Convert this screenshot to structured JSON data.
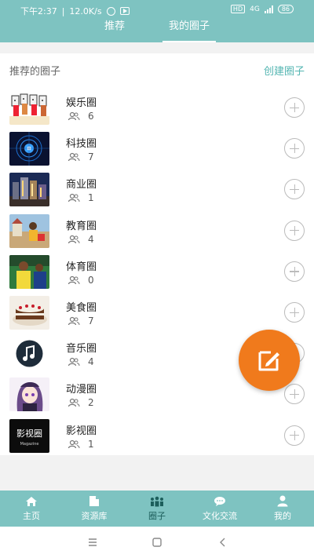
{
  "status_bar": {
    "time": "下午2:37",
    "speed": "12.0K/s",
    "network": "4G",
    "battery": "86"
  },
  "header": {
    "tabs": [
      {
        "label": "推荐",
        "active": false
      },
      {
        "label": "我的圈子",
        "active": true
      }
    ]
  },
  "section": {
    "title": "推荐的圈子",
    "create_label": "创建圈子"
  },
  "circles": [
    {
      "name": "娱乐圈",
      "members": "6",
      "icon": "entertainment-thumb"
    },
    {
      "name": "科技圈",
      "members": "7",
      "icon": "technology-thumb"
    },
    {
      "name": "商业圈",
      "members": "1",
      "icon": "business-thumb"
    },
    {
      "name": "教育圈",
      "members": "4",
      "icon": "education-thumb"
    },
    {
      "name": "体育圈",
      "members": "0",
      "icon": "sports-thumb"
    },
    {
      "name": "美食圈",
      "members": "7",
      "icon": "food-thumb"
    },
    {
      "name": "音乐圈",
      "members": "4",
      "icon": "music-thumb"
    },
    {
      "name": "动漫圈",
      "members": "2",
      "icon": "anime-thumb"
    },
    {
      "name": "影视圈",
      "members": "1",
      "icon": "film-thumb"
    }
  ],
  "thumb_text": {
    "film_title": "影视圈",
    "film_sub": "Magazine"
  },
  "bottom_nav": [
    {
      "label": "主页",
      "icon": "home-icon",
      "active": false
    },
    {
      "label": "资源库",
      "icon": "file-icon",
      "active": false
    },
    {
      "label": "圈子",
      "icon": "group-icon",
      "active": true
    },
    {
      "label": "文化交流",
      "icon": "chat-icon",
      "active": false
    },
    {
      "label": "我的",
      "icon": "person-icon",
      "active": false
    }
  ],
  "colors": {
    "header": "#7ec3c1",
    "accent": "#54b6b2",
    "fab": "#f07a1c",
    "active_nav": "#1d5f5c"
  }
}
